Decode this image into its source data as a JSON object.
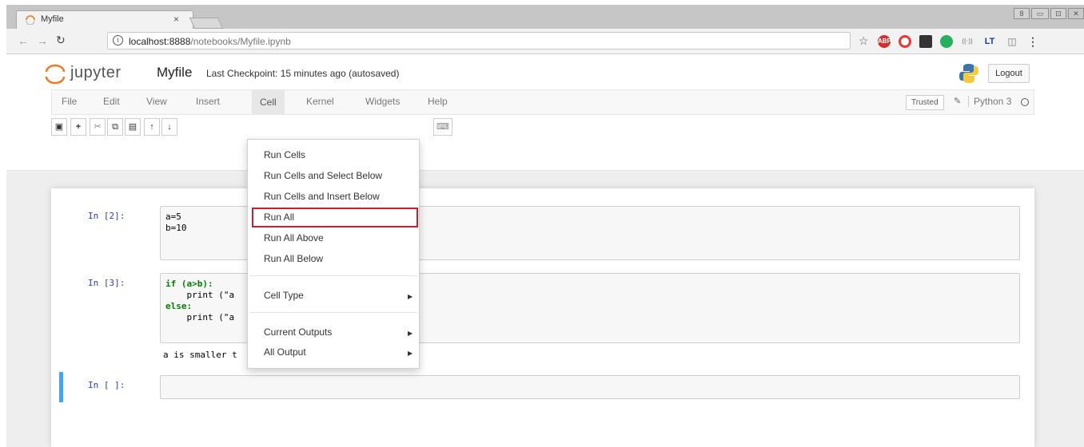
{
  "browser": {
    "tab_title": "Myfile",
    "tab_close": "×",
    "url_host": "localhost:8888",
    "url_path": "/notebooks/Myfile.ipynb",
    "window_controls": [
      "8",
      "▭",
      "⊡",
      "✕"
    ]
  },
  "header": {
    "logo_text": "jupyter",
    "notebook_name": "Myfile",
    "checkpoint": "Last Checkpoint: 15 minutes ago (autosaved)",
    "logout_label": "Logout"
  },
  "menubar": {
    "items": [
      "File",
      "Edit",
      "View",
      "Insert",
      "Cell",
      "Kernel",
      "Widgets",
      "Help"
    ],
    "trusted": "Trusted",
    "kernel": "Python 3"
  },
  "cells": [
    {
      "prompt": "In [2]:",
      "lines": [
        "a=5",
        "b=10"
      ]
    },
    {
      "prompt": "In [3]:",
      "lines": [
        "if (a>b):",
        "    print (\"a",
        "else:",
        "    print (\"a"
      ],
      "output": "a is smaller t"
    },
    {
      "prompt": "In [ ]:",
      "lines": []
    }
  ],
  "cell_menu": {
    "items": [
      "Run Cells",
      "Run Cells and Select Below",
      "Run Cells and Insert Below",
      "Run All",
      "Run All Above",
      "Run All Below",
      "Cell Type",
      "Current Outputs",
      "All Output"
    ],
    "highlighted": "Run All"
  },
  "colors": {
    "highlight": "#c8202a",
    "prompt": "#303f9f",
    "selected_cell": "#42a5f5"
  }
}
